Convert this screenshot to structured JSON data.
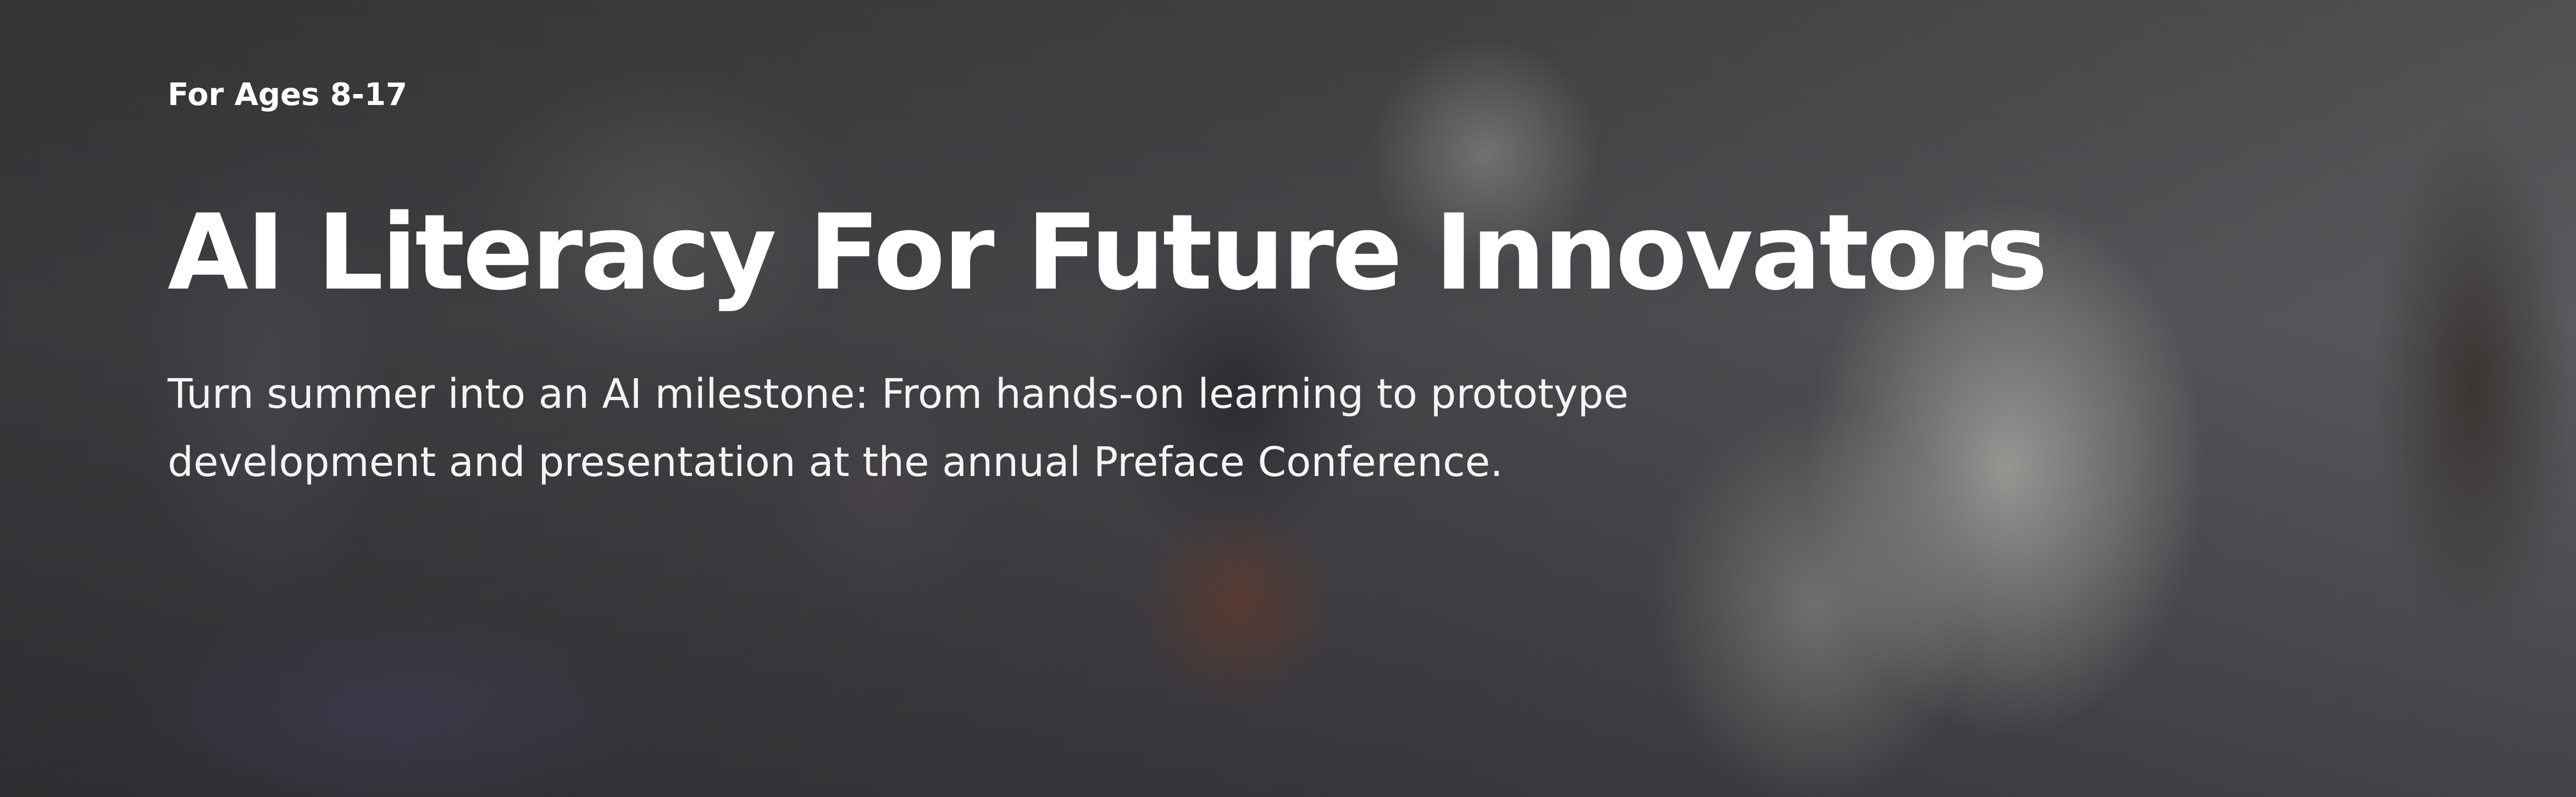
{
  "hero": {
    "eyebrow": "For Ages 8-17",
    "headline": "AI Literacy For Future Innovators",
    "subtitle": "Turn summer into an AI milestone: From hands-on learning to prototype development and presentation at the annual Preface Conference."
  }
}
